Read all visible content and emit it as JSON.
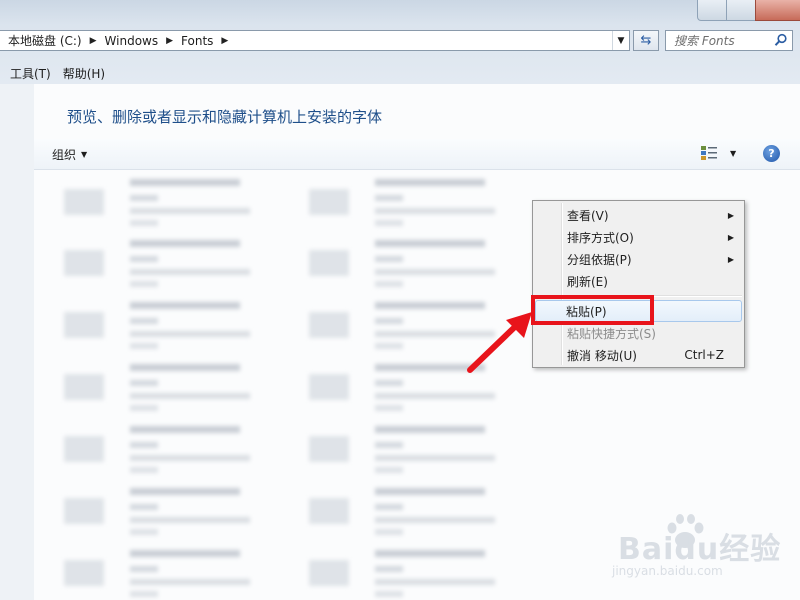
{
  "address": {
    "crumbs": [
      "本地磁盘 (C:)",
      "Windows",
      "Fonts"
    ]
  },
  "search": {
    "placeholder": "搜索 Fonts"
  },
  "menubar": {
    "items": [
      "工具(T)",
      "帮助(H)"
    ]
  },
  "content": {
    "heading": "预览、删除或者显示和隐藏计算机上安装的字体",
    "organize_label": "组织"
  },
  "context_menu": {
    "items": [
      {
        "label": "查看(V)",
        "submenu": true
      },
      {
        "label": "排序方式(O)",
        "submenu": true
      },
      {
        "label": "分组依据(P)",
        "submenu": true
      },
      {
        "label": "刷新(E)"
      },
      {
        "label": "粘贴(P)",
        "highlighted": true
      },
      {
        "label": "粘贴快捷方式(S)",
        "disabled": true
      },
      {
        "label": "撤消 移动(U)",
        "shortcut": "Ctrl+Z"
      }
    ]
  },
  "watermark": {
    "brand": "Baidu经验",
    "url": "jingyan.baidu.com"
  },
  "colors": {
    "highlight": "#e8141b",
    "heading": "#1f4f8a",
    "menu_bg": "#f0f0f0"
  },
  "icons": [
    "search-icon",
    "refresh-icon",
    "view-icon",
    "help-icon",
    "submenu-arrow-icon",
    "annotation-arrow-icon"
  ]
}
